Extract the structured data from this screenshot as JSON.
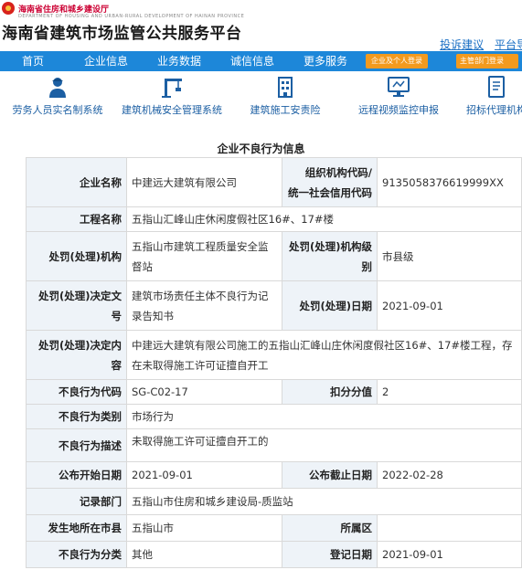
{
  "header": {
    "dept": "海南省住房和城乡建设厅",
    "dept_en": "DEPARTMENT OF HOUSING AND URBAN-RURAL DEVELOPMENT OF HAINAN PROVINCE",
    "title": "海南省建筑市场监管公共服务平台",
    "links": [
      "投诉建议",
      "平台导"
    ]
  },
  "nav": {
    "items": [
      "首页",
      "企业信息",
      "业务数据",
      "诚信信息",
      "更多服务"
    ],
    "login_company": "企业及个人登录",
    "login_dept": "主管部门登录"
  },
  "quick": [
    "劳务人员实名制系统",
    "建筑机械安全管理系统",
    "建筑施工安责险",
    "远程视频监控申报",
    "招标代理机构"
  ],
  "page_title": "企业不良行为信息",
  "record": {
    "company_label": "企业名称",
    "company": "中建远大建筑有限公司",
    "org_code_label_1": "组织机构代码/",
    "org_code_label_2": "统一社会信用代码",
    "org_code": "9135058376619999XX",
    "project_label": "工程名称",
    "project": "五指山汇峰山庄休闲度假社区16#、17#楼",
    "authority_label": "处罚(处理)机构",
    "authority_1": "五指山市建筑工程质量安全监",
    "authority_2": "督站",
    "authority_level_label_1": "处罚(处理)机构级",
    "authority_level_label_2": "别",
    "authority_level": "市县级",
    "decision_no_label_1": "处罚(处理)决定文",
    "decision_no_label_2": "号",
    "decision_no_1": "建筑市场责任主体不良行为记",
    "decision_no_2": "录告知书",
    "decision_date_label": "处罚(处理)日期",
    "decision_date": "2021-09-01",
    "content_label_1": "处罚(处理)决定内",
    "content_label_2": "容",
    "content_1": "中建远大建筑有限公司施工的五指山汇峰山庄休闲度假社区16#、17#楼工程，存",
    "content_2": "在未取得施工许可证擅自开工",
    "code_label": "不良行为代码",
    "code": "SG-C02-17",
    "score_label": "扣分分值",
    "score": "2",
    "category_label": "不良行为类别",
    "category": "市场行为",
    "desc_label": "不良行为描述",
    "desc": "未取得施工许可证擅自开工的",
    "pub_start_label": "公布开始日期",
    "pub_start": "2021-09-01",
    "pub_end_label": "公布截止日期",
    "pub_end": "2022-02-28",
    "record_dept_label": "记录部门",
    "record_dept": "五指山市住房和城乡建设局-质监站",
    "city_label": "发生地所在市县",
    "city": "五指山市",
    "district_label": "所属区",
    "district": "",
    "class_label": "不良行为分类",
    "class": "其他",
    "reg_date_label": "登记日期",
    "reg_date": "2021-09-01"
  }
}
